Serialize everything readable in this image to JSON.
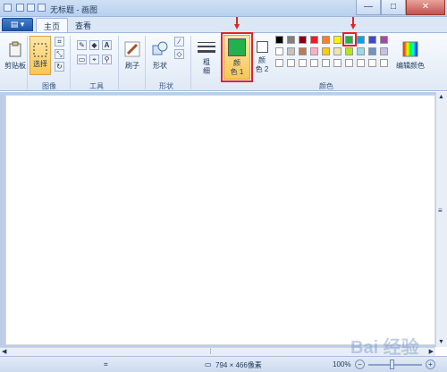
{
  "window": {
    "title": "无标题 - 画图",
    "controls": [
      "—",
      "□",
      "✕"
    ]
  },
  "ribbon_tabs": {
    "app_menu": "▤ ▾",
    "home": "主页",
    "view": "查看"
  },
  "groups": {
    "clipboard": {
      "label": "剪贴板"
    },
    "image": {
      "label": "图像",
      "select_label": "选择"
    },
    "tools": {
      "label": "工具"
    },
    "brushes": {
      "label": "刷子"
    },
    "shapes": {
      "label": "形状",
      "shapes_label": "形状"
    },
    "size": {
      "label": "粗\n细"
    },
    "colors": {
      "label": "颜色",
      "color1_label": "颜\n色 1",
      "color2_label": "颜\n色 2",
      "edit_colors_label": "编辑颜色",
      "color1_value": "#22b14c",
      "color2_value": "#ffffff",
      "palette_row1": [
        "#000000",
        "#7f7f7f",
        "#880015",
        "#ed1c24",
        "#ff7f27",
        "#fff200",
        "#22b14c",
        "#00a2e8",
        "#3f48cc",
        "#a349a4"
      ],
      "palette_row2": [
        "#ffffff",
        "#c3c3c3",
        "#b97a57",
        "#ffaec9",
        "#ffc90e",
        "#efe4b0",
        "#b5e61d",
        "#99d9ea",
        "#7092be",
        "#c8bfe7"
      ],
      "palette_row3": [
        "#ffffff",
        "#ffffff",
        "#ffffff",
        "#ffffff",
        "#ffffff",
        "#ffffff",
        "#ffffff",
        "#ffffff",
        "#ffffff",
        "#ffffff"
      ]
    }
  },
  "statusbar": {
    "dimensions": "794 × 466像素",
    "zoom": "100%"
  },
  "watermark": "Bai 经验"
}
